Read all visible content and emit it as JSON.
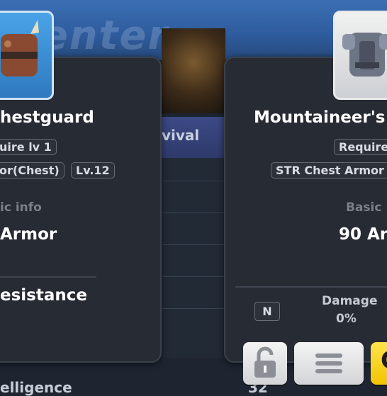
{
  "background": {
    "banner_text": "Menter",
    "list_tab_label": "vival",
    "stat_label": "elligence",
    "stat_value": "32"
  },
  "left_card": {
    "title": "hestguard",
    "require_label": "uire lv 1",
    "type_chip": "or(Chest)",
    "level_chip": "Lv.12",
    "basic_info_label": "ic info",
    "armor_label": "Armor",
    "resistance_label": "esistance"
  },
  "right_card": {
    "title": "Mountaineer's",
    "require_label": "Require",
    "type_chip": "STR Chest Armor",
    "basic_info_label": "Basic I",
    "armor_label": "90 Ar",
    "damage_label": "Damage",
    "damage_value": "0%",
    "n_badge": "N"
  },
  "buttons": {
    "lock_icon": "lock-icon",
    "menu_icon": "menu-icon",
    "equip_glyph": "C"
  },
  "colors": {
    "panel_bg": "#272b33",
    "equip_button": "#f2c400",
    "banner_blue": "#3a6fb4"
  }
}
